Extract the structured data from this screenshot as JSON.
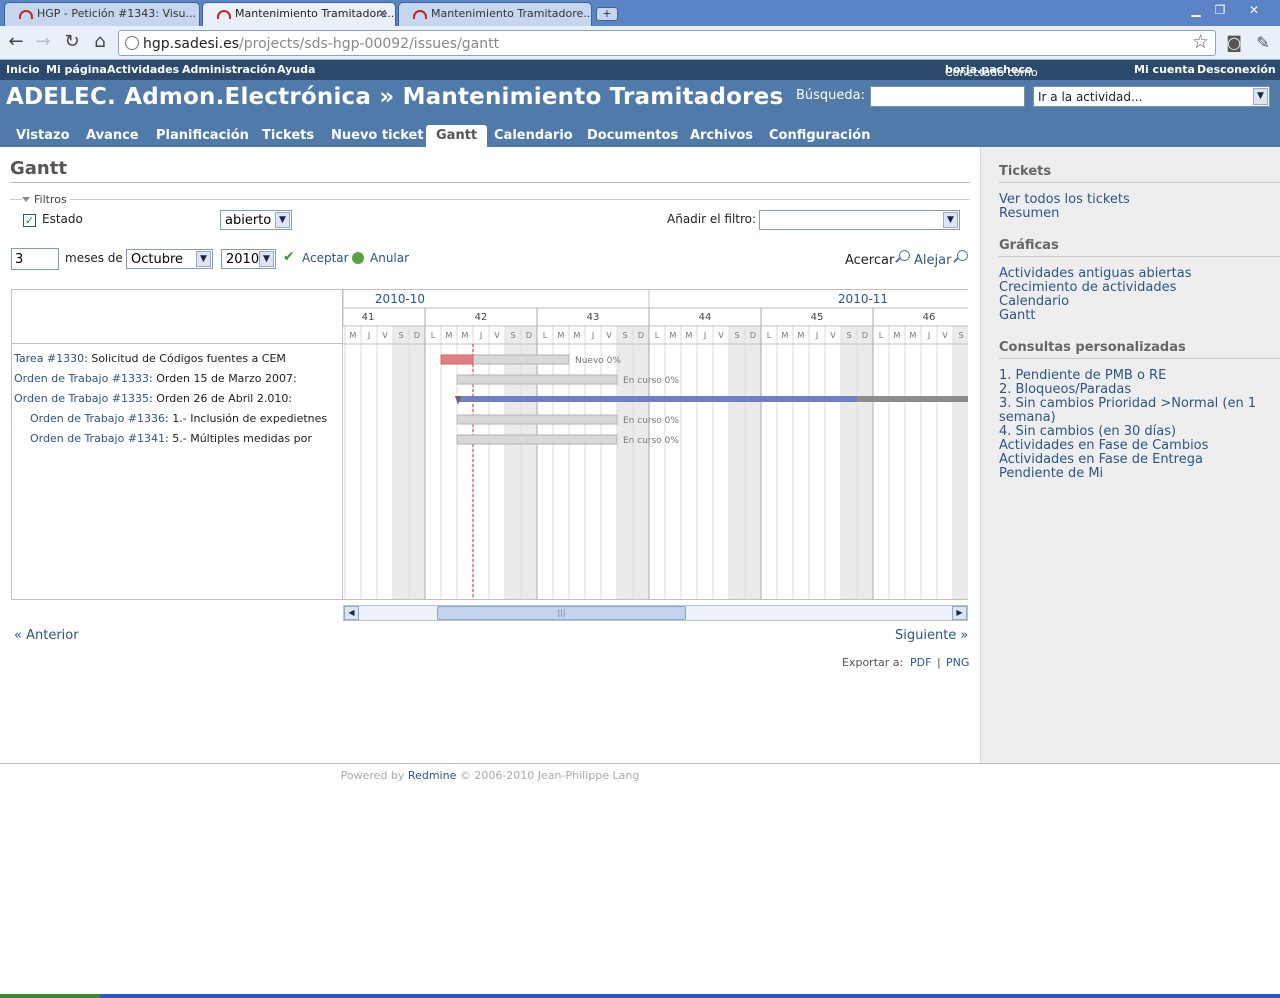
{
  "browser": {
    "tabs": [
      {
        "title": "HGP - Petición #1343: Visu..."
      },
      {
        "title": "Mantenimiento Tramitadore..."
      },
      {
        "title": "Mantenimiento Tramitadore..."
      }
    ],
    "new_tab": "+",
    "url_host": "hgp.sadesi.es",
    "url_path": "/projects/sds-hgp-00092/issues/gantt",
    "win_min": "▁",
    "win_max": "❐",
    "win_close": "✕"
  },
  "topmenu": {
    "items": [
      "Inicio",
      "Mi página",
      "Actividades",
      "Administración",
      "Ayuda"
    ],
    "logged_as_prefix": "Conectado como",
    "logged_user": "borja.pacheco",
    "my_account": "Mi cuenta",
    "logout": "Desconexión"
  },
  "header": {
    "title": "ADELEC. Admon.Electrónica » Mantenimiento Tramitadores",
    "search_label": "Búsqueda:",
    "search_value": "",
    "jump_label": "Ir a la actividad..."
  },
  "mainmenu": {
    "items": [
      "Vistazo",
      "Avance",
      "Planificación",
      "Tickets",
      "Nuevo ticket",
      "Gantt",
      "Calendario",
      "Documentos",
      "Archivos",
      "Configuración"
    ],
    "selected": "Gantt"
  },
  "page": {
    "title": "Gantt",
    "filters_legend": "Filtros",
    "filter_estado_label": "Estado",
    "filter_estado_value": "abierto",
    "add_filter_label": "Añadir el filtro:",
    "add_filter_value": "",
    "months_value": "3",
    "months_label": "meses de",
    "month_value": "Octubre",
    "year_value": "2010",
    "apply": "Aceptar",
    "clear": "Anular",
    "zoom_in": "Acercar",
    "zoom_out": "Alejar",
    "prev": "« Anterior",
    "next": "Siguiente »",
    "export_label": "Exportar a:",
    "export_pdf": "PDF",
    "export_sep": "|",
    "export_png": "PNG"
  },
  "gantt": {
    "months": [
      "2010-10",
      "2010-11"
    ],
    "weeks": [
      "41",
      "42",
      "43",
      "44",
      "45",
      "46"
    ],
    "day_letters": [
      "M",
      "J",
      "V",
      "S",
      "D",
      "L",
      "M",
      "M",
      "J",
      "V",
      "S",
      "D",
      "L",
      "M",
      "M",
      "J",
      "V",
      "S",
      "D",
      "L",
      "M",
      "M",
      "J",
      "V",
      "S",
      "D",
      "L",
      "M",
      "M",
      "J",
      "V",
      "S",
      "D",
      "L",
      "M",
      "M",
      "J",
      "V",
      "S"
    ],
    "issues": [
      {
        "indent": 0,
        "tracker": "Tarea #1330",
        "subject": ": Solicitud de Códigos fuentes a CEM",
        "status": "Nuevo",
        "done": "0%",
        "bar_color": "#e08080",
        "progress": 0
      },
      {
        "indent": 0,
        "tracker": "Orden de Trabajo #1333",
        "subject": ": Orden 15 de Marzo 2007:",
        "status": "En curso",
        "done": "0%",
        "bar_color": "#c0c0c0",
        "progress": 0
      },
      {
        "indent": 0,
        "tracker": "Orden de Trabajo #1335",
        "subject": ": Orden 26 de Abril 2.010:",
        "status": "",
        "done": "",
        "bar_color": "#6c7fc8",
        "progress": 0
      },
      {
        "indent": 1,
        "tracker": "Orden de Trabajo #1336",
        "subject": ": 1.- Inclusión de expedietnes",
        "status": "En curso",
        "done": "0%",
        "bar_color": "#c0c0c0",
        "progress": 0
      },
      {
        "indent": 1,
        "tracker": "Orden de Trabajo #1341",
        "subject": ": 5.- Múltiples medidas por",
        "status": "En curso",
        "done": "0%",
        "bar_color": "#c0c0c0",
        "progress": 0
      }
    ]
  },
  "footer": {
    "powered_by": "Powered by",
    "redmine": "Redmine",
    "copyright": "© 2006-2010 Jean-Philippe Lang"
  },
  "sidebar": {
    "tickets_title": "Tickets",
    "tickets_links": [
      "Ver todos los tickets",
      "Resumen"
    ],
    "charts_title": "Gráficas",
    "charts_links": [
      "Actividades antiguas abiertas",
      "Crecimiento de actividades",
      "Calendario",
      "Gantt"
    ],
    "queries_title": "Consultas personalizadas",
    "queries_links": [
      "1. Pendiente de PMB o RE",
      "2. Bloqueos/Paradas",
      "3. Sin cambios Prioridad >Normal (en 1 semana)",
      "4. Sin cambios (en 30 días)",
      "Actividades en Fase de Cambios",
      "Actividades en Fase de Entrega",
      "Pendiente de Mi"
    ]
  }
}
